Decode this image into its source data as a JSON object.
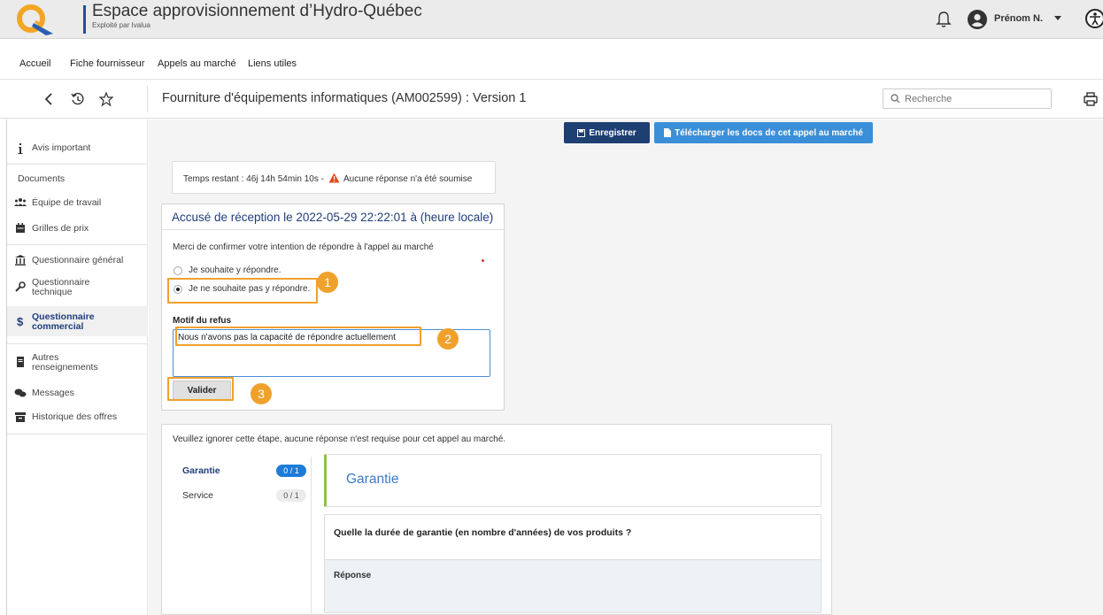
{
  "header": {
    "title": "Espace approvisionnement d’Hydro-Québec",
    "subtitle": "Exploité par Ivalua",
    "user_name": "Prénom N."
  },
  "nav": {
    "items": [
      {
        "label": "Accueil"
      },
      {
        "label": "Fiche fournisseur"
      },
      {
        "label": "Appels au marché"
      },
      {
        "label": "Liens utiles"
      }
    ]
  },
  "titlebar": {
    "page_title": "Fourniture d'équipements informatiques (AM002599) : Version 1",
    "search_placeholder": "Recherche"
  },
  "sidebar": {
    "items": [
      {
        "label": "Avis important",
        "icon": "info-icon"
      },
      {
        "label": "Documents",
        "icon": ""
      },
      {
        "label": "Équipe de travail",
        "icon": "team-icon"
      },
      {
        "label": "Grilles de prix",
        "icon": "price-grid-icon"
      },
      {
        "label": "Questionnaire général",
        "icon": "bank-icon"
      },
      {
        "label": "Questionnaire technique",
        "icon": "wrench-icon"
      },
      {
        "label": "Questionnaire commercial",
        "icon": "dollar-icon"
      },
      {
        "label": "Autres renseignements",
        "icon": "book-icon"
      },
      {
        "label": "Messages",
        "icon": "messages-icon"
      },
      {
        "label": "Historique des offres",
        "icon": "archive-icon"
      }
    ]
  },
  "actions": {
    "save_label": "Enregistrer",
    "download_label": "Télécharger les docs de cet appel au marché"
  },
  "timer": {
    "label": "Temps restant :",
    "value": "46j 14h 54min 10s -",
    "warning": "Aucune réponse n'a été soumise"
  },
  "acknowledgement": {
    "title": "Accusé de réception le 2022-05-29 22:22:01 à (heure locale)",
    "question": "Merci de confirmer votre intention de répondre à l'appel au marché",
    "options": [
      {
        "label": "Je souhaite y répondre.",
        "checked": false
      },
      {
        "label": "Je ne souhaite pas y répondre.",
        "checked": true
      }
    ],
    "refusal_label": "Motif du refus",
    "refusal_value": "Nous n'avons pas la capacité de répondre actuellement",
    "validate_label": "Valider"
  },
  "callouts": [
    "1",
    "2",
    "3"
  ],
  "lower": {
    "note": "Veuillez ignorer cette étape, aucune réponse n'est requise pour cet appel au marché.",
    "tabs": [
      {
        "label": "Garantie",
        "count": "0 / 1",
        "selected": true
      },
      {
        "label": "Service",
        "count": "0 / 1",
        "selected": false
      }
    ],
    "section_title": "Garantie",
    "question": "Quelle la durée de garantie (en nombre d'années) de vos produits ?",
    "answer_label": "Réponse"
  },
  "colors": {
    "primary_dark": "#1d3f72",
    "primary_light": "#3a8fd8",
    "highlight": "#f0a12c",
    "warning": "#e24d1f",
    "accent_green": "#8bc34a"
  }
}
